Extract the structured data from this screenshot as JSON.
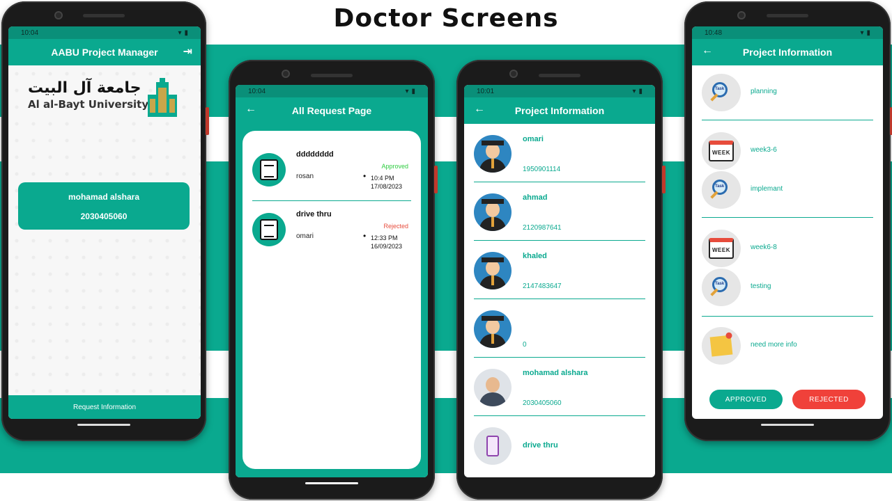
{
  "headline": "Doctor Screens",
  "phone1": {
    "status_time": "10:04",
    "title": "AABU Project Manager",
    "logo_ar": "جامعة آل البيت",
    "logo_en": "Al al-Bayt University",
    "user_name": "mohamad alshara",
    "user_id": "2030405060",
    "bottom_label": "Request Information"
  },
  "phone2": {
    "status_time": "10:04",
    "title": "All Request Page",
    "requests": [
      {
        "title": "dddddddd",
        "who": "rosan",
        "status": "Approved",
        "time": "10:4 PM",
        "date": "17/08/2023"
      },
      {
        "title": "drive thru",
        "who": "omari",
        "status": "Rejected",
        "time": "12:33 PM",
        "date": "16/09/2023"
      }
    ],
    "colors": {
      "approved": "#2ecc40",
      "rejected": "#e74c3c"
    }
  },
  "phone3": {
    "status_time": "10:01",
    "title": "Project Information",
    "members": [
      {
        "name": "omari",
        "id": "1950901114"
      },
      {
        "name": "ahmad",
        "id": "2120987641"
      },
      {
        "name": "khaled",
        "id": "2147483647"
      },
      {
        "name": "",
        "id": "0"
      },
      {
        "name": "mohamad alshara",
        "id": "2030405060"
      },
      {
        "name": "drive thru",
        "id": ""
      }
    ]
  },
  "phone4": {
    "status_time": "10:48",
    "title": "Project Information",
    "tasks": [
      "planning",
      "week3-6",
      "implemant",
      "week6-8",
      "testing",
      "need more info"
    ],
    "task_icon_label": "Task",
    "week_icon_label": "WEEK",
    "approve_label": "APPROVED",
    "reject_label": "REJECTED"
  },
  "colors": {
    "teal": "#0aa98f",
    "dark_teal": "#0a8f79",
    "reject_red": "#f0413a"
  }
}
